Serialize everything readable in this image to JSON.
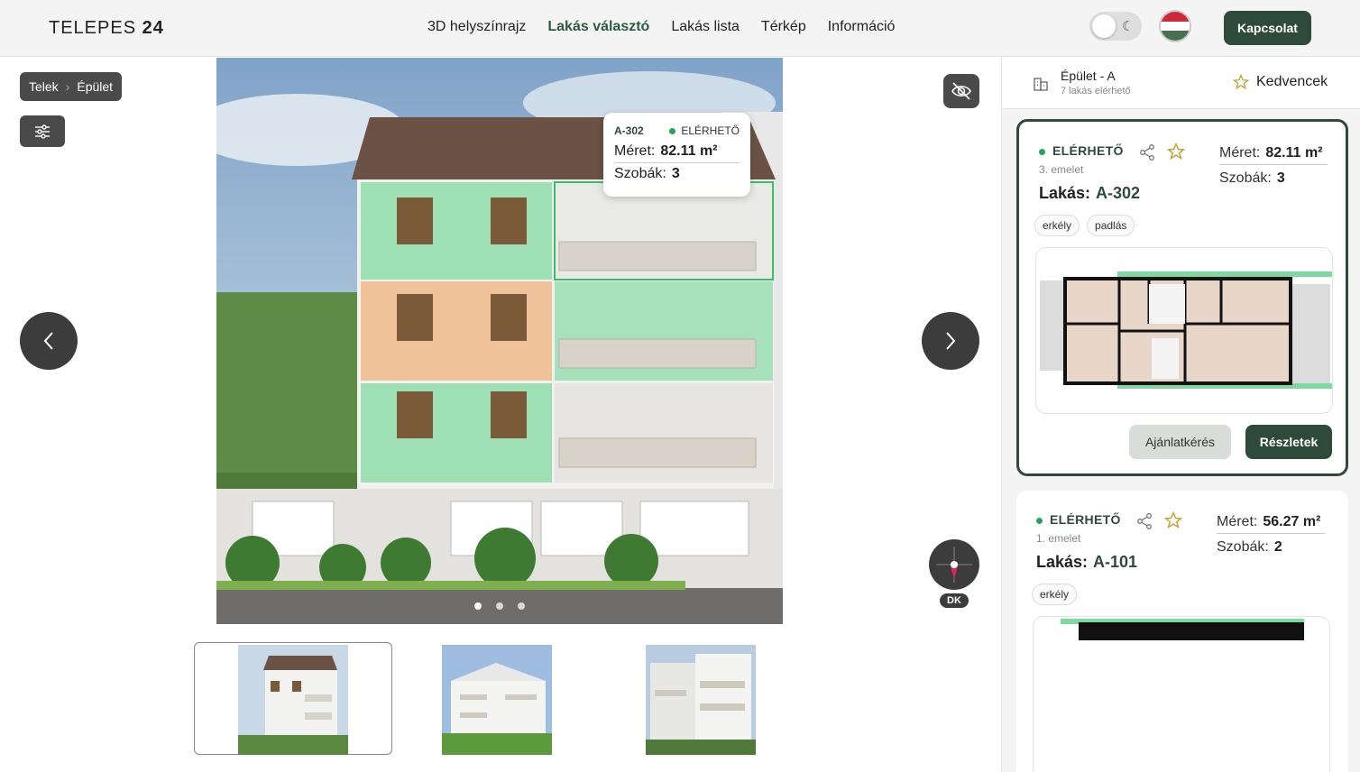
{
  "brand": {
    "name_light": "TELEPES",
    "name_bold": "24"
  },
  "nav": {
    "items": [
      "3D helyszínrajz",
      "Lakás választó",
      "Lakás lista",
      "Térkép",
      "Információ"
    ],
    "active": "Lakás választó"
  },
  "header": {
    "contact_label": "Kapcsolat"
  },
  "breadcrumb": {
    "items": [
      "Telek",
      "Épület"
    ]
  },
  "tooltip": {
    "unit": "A-302",
    "status": "ELÉRHETŐ",
    "size_label": "Méret:",
    "size_value": "82.11 m²",
    "rooms_label": "Szobák:",
    "rooms_value": "3"
  },
  "compass": {
    "label": "DK"
  },
  "carousel": {
    "count": 3,
    "active": 0
  },
  "sidebar": {
    "building_title": "Épület - A",
    "building_subtitle": "7 lakás elérhető",
    "favorites_label": "Kedvencek",
    "cards": [
      {
        "status": "ELÉRHETŐ",
        "floor": "3. emelet",
        "unit_label": "Lakás:",
        "unit": "A-302",
        "size_label": "Méret:",
        "size": "82.11 m²",
        "rooms_label": "Szobák:",
        "rooms": "3",
        "tags": [
          "erkély",
          "padlás"
        ],
        "quote_label": "Ajánlatkérés",
        "details_label": "Részletek"
      },
      {
        "status": "ELÉRHETŐ",
        "floor": "1. emelet",
        "unit_label": "Lakás:",
        "unit": "A-101",
        "size_label": "Méret:",
        "size": "56.27 m²",
        "rooms_label": "Szobák:",
        "rooms": "2",
        "tags": [
          "erkély"
        ]
      }
    ]
  },
  "colors": {
    "accent": "#2d4a3a",
    "available": "#25a55a",
    "highlight": "#7ed9a1"
  },
  "icons": {
    "filter": "sliders-icon",
    "hide": "eye-off-icon",
    "prev": "chevron-left-icon",
    "next": "chevron-right-icon",
    "share": "share-icon",
    "star": "star-icon",
    "building": "building-icon",
    "moon": "moon-icon"
  }
}
